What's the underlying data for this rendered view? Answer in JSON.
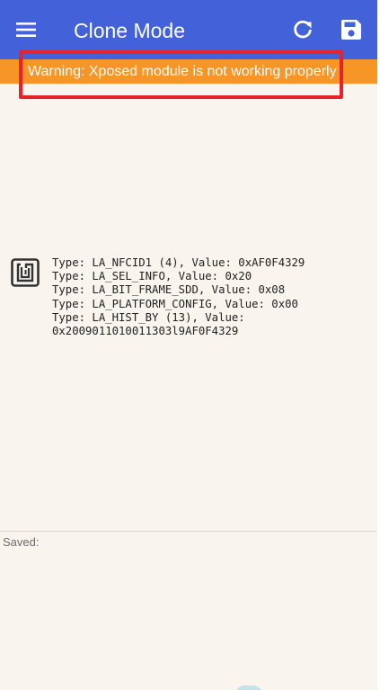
{
  "toolbar": {
    "title": "Clone Mode",
    "menu_icon": "hamburger-menu-icon",
    "refresh_icon": "refresh-icon",
    "save_icon": "floppy-save-icon",
    "background_color": "#4361d8"
  },
  "warning": {
    "text": "Warning: Xposed module is not working properly",
    "background_color": "#f79626",
    "highlight_color": "#e8222a"
  },
  "tag": {
    "icon": "nfc-tag-icon",
    "lines": [
      "Type: LA_NFCID1 (4), Value: 0xAF0F4329",
      "Type: LA_SEL_INFO, Value: 0x20",
      "Type: LA_BIT_FRAME_SDD, Value: 0x08",
      "Type: LA_PLATFORM_CONFIG, Value: 0x00",
      "Type: LA_HIST_BY (13), Value:",
      "0x2009011010011303l9AF0F4329"
    ]
  },
  "saved": {
    "label": "Saved:"
  }
}
